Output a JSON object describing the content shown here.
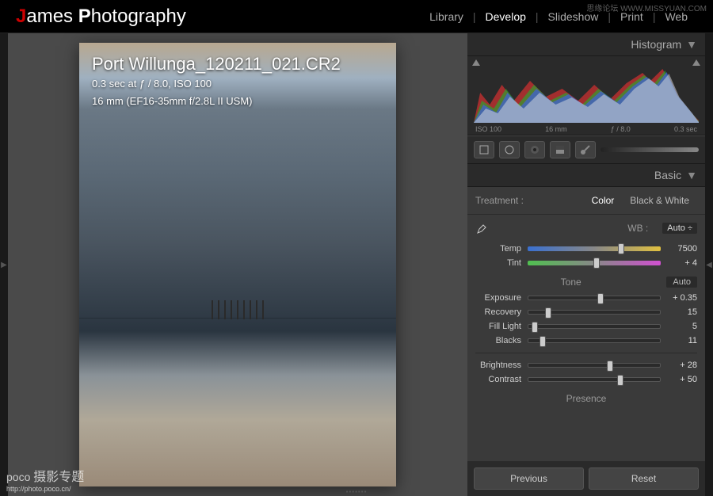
{
  "brand": {
    "part1": "J",
    "part2": "ames ",
    "part3": "P",
    "part4": "hotography"
  },
  "nav": {
    "items": [
      {
        "label": "Library",
        "active": false
      },
      {
        "label": "Develop",
        "active": true
      },
      {
        "label": "Slideshow",
        "active": false
      },
      {
        "label": "Print",
        "active": false
      },
      {
        "label": "Web",
        "active": false
      }
    ]
  },
  "photo": {
    "title": "Port Willunga_120211_021.CR2",
    "meta1": "0.3 sec at ƒ / 8.0, ISO 100",
    "meta2": "16 mm (EF16-35mm f/2.8L II USM)"
  },
  "panel": {
    "histogram_label": "Histogram",
    "histo_ticks": {
      "iso": "ISO 100",
      "focal": "16 mm",
      "aperture": "ƒ / 8.0",
      "shutter": "0.3 sec"
    },
    "basic_label": "Basic",
    "treatment": {
      "label": "Treatment :",
      "color": "Color",
      "bw": "Black & White"
    },
    "wb": {
      "label": "WB :",
      "value": "Auto ÷"
    },
    "sliders": {
      "temp": {
        "label": "Temp",
        "value": "7500",
        "pos": 70
      },
      "tint": {
        "label": "Tint",
        "value": "+ 4",
        "pos": 52
      },
      "tone_label": "Tone",
      "auto_label": "Auto",
      "exposure": {
        "label": "Exposure",
        "value": "+ 0.35",
        "pos": 55
      },
      "recovery": {
        "label": "Recovery",
        "value": "15",
        "pos": 15
      },
      "fill": {
        "label": "Fill Light",
        "value": "5",
        "pos": 5
      },
      "blacks": {
        "label": "Blacks",
        "value": "11",
        "pos": 11
      },
      "brightness": {
        "label": "Brightness",
        "value": "+ 28",
        "pos": 62
      },
      "contrast": {
        "label": "Contrast",
        "value": "+ 50",
        "pos": 70
      },
      "presence_label": "Presence"
    },
    "buttons": {
      "previous": "Previous",
      "reset": "Reset"
    }
  },
  "watermarks": {
    "tr": "思缘论坛 WWW.MISSYUAN.COM",
    "bl_brand": "poco",
    "bl_cn": "摄影专题",
    "bl_url": "http://photo.poco.cn/"
  }
}
